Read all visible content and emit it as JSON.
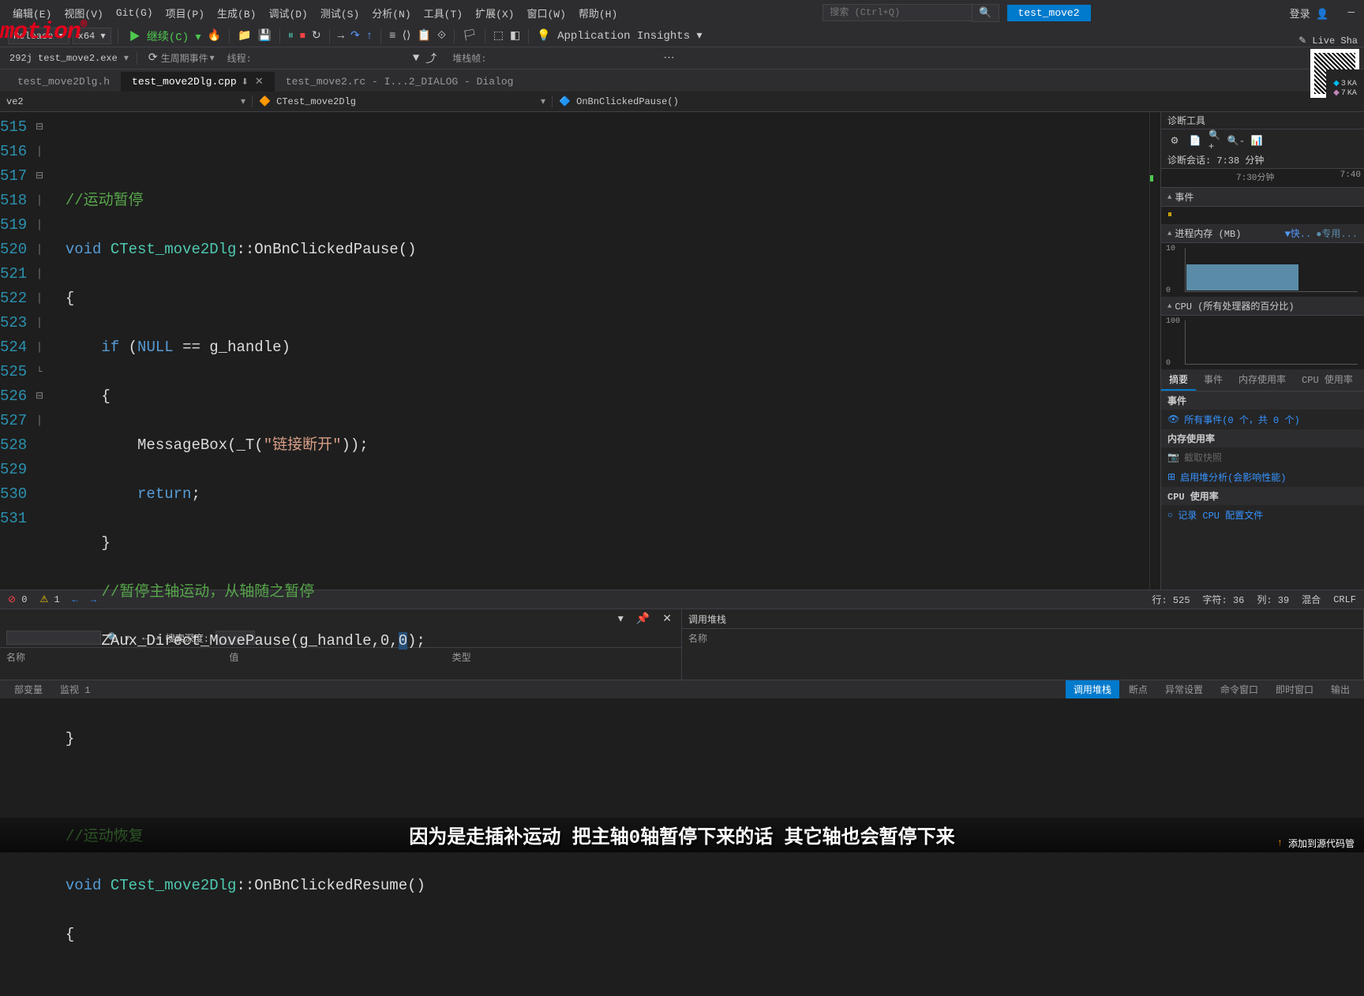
{
  "menubar": {
    "items": [
      "编辑(E)",
      "视图(V)",
      "Git(G)",
      "项目(P)",
      "生成(B)",
      "调试(D)",
      "测试(S)",
      "分析(N)",
      "工具(T)",
      "扩展(X)",
      "窗口(W)",
      "帮助(H)"
    ],
    "search_placeholder": "搜索 (Ctrl+Q)",
    "solution": "test_move2",
    "login": "登录"
  },
  "toolbar": {
    "config": "Release",
    "platform": "x64",
    "continue": "继续(C)",
    "appinsights": "Application Insights"
  },
  "toolbar2": {
    "process": "292j test_move2.exe",
    "lifecycle": "生周期事件",
    "thread_label": "线程:",
    "stackframe": "堆栈帧:"
  },
  "liveshare": "Live Sha",
  "tabs": {
    "t1": "test_move2Dlg.h",
    "t2": "test_move2Dlg.cpp",
    "t3": "test_move2.rc - I...2_DIALOG - Dialog"
  },
  "nav": {
    "scope": "ve2",
    "class": "CTest_move2Dlg",
    "func": "OnBnClickedPause()"
  },
  "lines": [
    "515",
    "516",
    "517",
    "518",
    "519",
    "520",
    "521",
    "522",
    "523",
    "524",
    "525",
    "526",
    "527",
    "528",
    "529",
    "530",
    "531"
  ],
  "code": {
    "c516": "//运动暂停",
    "c517_kw": "void",
    "c517_cls": "CTest_move2Dlg",
    "c517_fn": "OnBnClickedPause",
    "c519_kw": "if",
    "c519_null": "NULL",
    "c519_var": "g_handle",
    "c521_fn": "MessageBox",
    "c521_t": "_T",
    "c521_str": "\"链接断开\"",
    "c522_kw": "return",
    "c524": "//暂停主轴运动，从轴随之暂停",
    "c525_fn": "ZAux_Direct_MovePause",
    "c525_args_a": "g_handle,0,",
    "c525_args_b": "0",
    "c529": "//运动恢复",
    "c530_kw": "void",
    "c530_cls": "CTest_move2Dlg",
    "c530_fn": "OnBnClickedResume"
  },
  "diag": {
    "title": "诊断工具",
    "session": "诊断会话: 7:38 分钟",
    "time_a": "7:30分钟",
    "time_b": "7:40",
    "events": "事件",
    "mem_head": "进程内存 (MB)",
    "mem_fast": "快..",
    "mem_private": "专用...",
    "mem_top": "10",
    "mem_bot": "0",
    "cpu_head": "CPU (所有处理器的百分比)",
    "cpu_top": "100",
    "cpu_bot": "0",
    "tab_summary": "摘要",
    "tab_events": "事件",
    "tab_mem": "内存使用率",
    "tab_cpu": "CPU 使用率",
    "sec_events": "事件",
    "all_events": "所有事件(0 个，共 0 个)",
    "sec_mem": "内存使用率",
    "snapshot": "截取快照",
    "heap": "启用堆分析(会影响性能)",
    "sec_cpu": "CPU 使用率",
    "cpu_profile": "记录 CPU 配置文件"
  },
  "badges": {
    "n1": "3",
    "k1": "KA",
    "n2": "7",
    "k2": "KA"
  },
  "status": {
    "errors": "0",
    "warnings": "1",
    "line": "行: 525",
    "chars": "字符: 36",
    "col": "列: 39",
    "mode": "混合",
    "eol": "CRLF"
  },
  "bottom_left": {
    "depth_label": "搜索深度:",
    "col_name": "名称",
    "col_value": "值",
    "col_type": "类型"
  },
  "bottom_right": {
    "title": "调用堆栈",
    "col_name": "名称"
  },
  "bottom_tabs_l": [
    "部变量",
    "监视 1"
  ],
  "bottom_tabs_r": [
    "调用堆栈",
    "断点",
    "异常设置",
    "命令窗口",
    "即时窗口",
    "输出"
  ],
  "subtitle": "因为是走插补运动  把主轴0轴暂停下来的话  其它轴也会暂停下来",
  "footer_src": "添加到源代码管"
}
